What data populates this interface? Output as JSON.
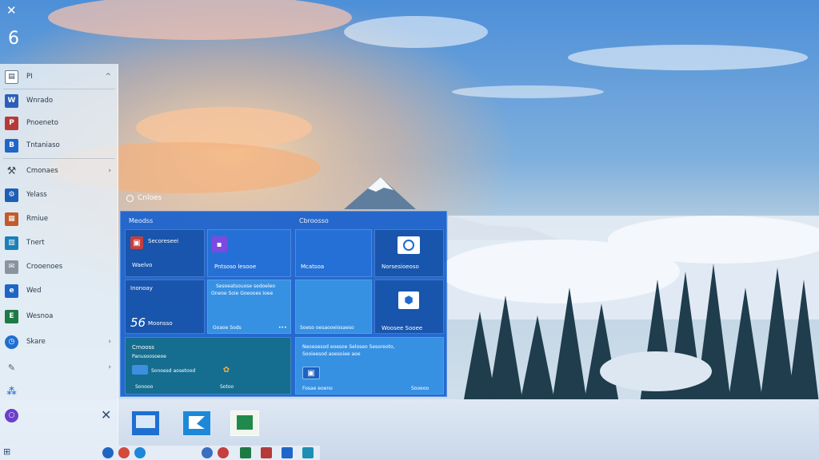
{
  "corner": {
    "icon": "tools-icon",
    "glyph": "✕",
    "number": "6"
  },
  "sidebar": {
    "top": {
      "label": "PI",
      "icon": "document-icon",
      "chevron": "^"
    },
    "items": [
      {
        "label": "Wnrado",
        "icon": "word-icon",
        "color": "#2b5fb8"
      },
      {
        "label": "Pnoeneto",
        "icon": "powerpoint-icon",
        "color": "#b53a3a"
      },
      {
        "label": "Tntaniaso",
        "icon": "excel-icon",
        "color": "#1e66c9"
      },
      {
        "label": "Cmonaes",
        "icon": "tools-icon",
        "color": "#444c56",
        "chevron": "›"
      },
      {
        "label": "Yelass",
        "icon": "settings-icon",
        "color": "#1e5fb5"
      },
      {
        "label": "Rmiue",
        "icon": "photos-icon",
        "color": "#c25a2a"
      },
      {
        "label": "Tnert",
        "icon": "store-icon",
        "color": "#1d7fb5"
      },
      {
        "label": "Crooenoes",
        "icon": "mail-icon",
        "color": "#8a93a0"
      },
      {
        "label": "Wed",
        "icon": "edge-icon",
        "color": "#1f66c4"
      },
      {
        "label": "Wesnoa",
        "icon": "excel-green-icon",
        "color": "#1e7a45"
      },
      {
        "label": "Skare",
        "icon": "clock-icon",
        "color": "#1f6fd0",
        "chevron": "›"
      },
      {
        "label": "",
        "icon": "pen-icon",
        "color": "#4a5a70",
        "chevron": "›"
      },
      {
        "label": "",
        "icon": "network-icon",
        "color": "#3a7fd0"
      },
      {
        "label": "",
        "icon": "cortana-icon",
        "color": "#6b3fc9"
      }
    ],
    "close_glyph": "✕"
  },
  "start": {
    "header": "Cnloes"
  },
  "panel": {
    "group_left": "Meodss",
    "group_right": "Cbroosso",
    "tiles": {
      "t1": {
        "title": "Secoreseei",
        "sub": "Waelvo",
        "name": "tile-secoreseei"
      },
      "t2": {
        "title": "Pntsoso lesooe",
        "name": "tile-pntsoso"
      },
      "t3": {
        "title": "Mcatsoa",
        "name": "tile-mcatsoa"
      },
      "t4": {
        "title": "Norsesioeoso",
        "name": "tile-norsesioeoso"
      },
      "t5": {
        "title": "Inonoay",
        "big": "56",
        "sub": "Moonsso",
        "name": "tile-inonoay"
      },
      "t6": {
        "line1": "Sesoeatsouose sedoeleo",
        "line2": "Oneoe Soie Goeooes Ioee",
        "foot": "Goaoe Sods",
        "foot2": "•••",
        "name": "tile-sesoeat"
      },
      "t7": {
        "title": "Soeso oesaooeiosaeso",
        "name": "tile-soeso"
      },
      "t8": {
        "title": "Woosee Sooee",
        "name": "tile-woosee"
      },
      "t9": {
        "title": "Crnooss",
        "sub": "Panusoosoeoe",
        "sub2": "Sonoesd aosetood",
        "foot": "Sonooo",
        "foot2": "Sotoo",
        "name": "tile-crnooss"
      },
      "t10": {
        "line1": "Neoesesod eoesoe Seloseo Sesoreoto,",
        "line2": "Sooieesod aoesoiee aoe",
        "foot": "Fosae eoeno",
        "foot2": "Sooeoo",
        "name": "tile-neoesesod"
      }
    }
  },
  "taskbar": {
    "start_glyph": "⊞"
  },
  "colors": {
    "panel": "#1760cd",
    "tile": "#2571d6",
    "sidebar": "#e8f0f8"
  }
}
